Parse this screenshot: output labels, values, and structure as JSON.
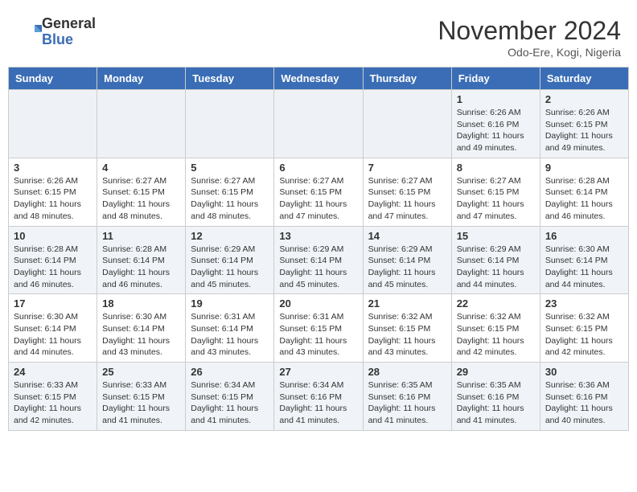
{
  "header": {
    "logo_general": "General",
    "logo_blue": "Blue",
    "month_title": "November 2024",
    "location": "Odo-Ere, Kogi, Nigeria"
  },
  "days_of_week": [
    "Sunday",
    "Monday",
    "Tuesday",
    "Wednesday",
    "Thursday",
    "Friday",
    "Saturday"
  ],
  "weeks": [
    [
      {
        "day": "",
        "info": ""
      },
      {
        "day": "",
        "info": ""
      },
      {
        "day": "",
        "info": ""
      },
      {
        "day": "",
        "info": ""
      },
      {
        "day": "",
        "info": ""
      },
      {
        "day": "1",
        "info": "Sunrise: 6:26 AM\nSunset: 6:16 PM\nDaylight: 11 hours\nand 49 minutes."
      },
      {
        "day": "2",
        "info": "Sunrise: 6:26 AM\nSunset: 6:15 PM\nDaylight: 11 hours\nand 49 minutes."
      }
    ],
    [
      {
        "day": "3",
        "info": "Sunrise: 6:26 AM\nSunset: 6:15 PM\nDaylight: 11 hours\nand 48 minutes."
      },
      {
        "day": "4",
        "info": "Sunrise: 6:27 AM\nSunset: 6:15 PM\nDaylight: 11 hours\nand 48 minutes."
      },
      {
        "day": "5",
        "info": "Sunrise: 6:27 AM\nSunset: 6:15 PM\nDaylight: 11 hours\nand 48 minutes."
      },
      {
        "day": "6",
        "info": "Sunrise: 6:27 AM\nSunset: 6:15 PM\nDaylight: 11 hours\nand 47 minutes."
      },
      {
        "day": "7",
        "info": "Sunrise: 6:27 AM\nSunset: 6:15 PM\nDaylight: 11 hours\nand 47 minutes."
      },
      {
        "day": "8",
        "info": "Sunrise: 6:27 AM\nSunset: 6:15 PM\nDaylight: 11 hours\nand 47 minutes."
      },
      {
        "day": "9",
        "info": "Sunrise: 6:28 AM\nSunset: 6:14 PM\nDaylight: 11 hours\nand 46 minutes."
      }
    ],
    [
      {
        "day": "10",
        "info": "Sunrise: 6:28 AM\nSunset: 6:14 PM\nDaylight: 11 hours\nand 46 minutes."
      },
      {
        "day": "11",
        "info": "Sunrise: 6:28 AM\nSunset: 6:14 PM\nDaylight: 11 hours\nand 46 minutes."
      },
      {
        "day": "12",
        "info": "Sunrise: 6:29 AM\nSunset: 6:14 PM\nDaylight: 11 hours\nand 45 minutes."
      },
      {
        "day": "13",
        "info": "Sunrise: 6:29 AM\nSunset: 6:14 PM\nDaylight: 11 hours\nand 45 minutes."
      },
      {
        "day": "14",
        "info": "Sunrise: 6:29 AM\nSunset: 6:14 PM\nDaylight: 11 hours\nand 45 minutes."
      },
      {
        "day": "15",
        "info": "Sunrise: 6:29 AM\nSunset: 6:14 PM\nDaylight: 11 hours\nand 44 minutes."
      },
      {
        "day": "16",
        "info": "Sunrise: 6:30 AM\nSunset: 6:14 PM\nDaylight: 11 hours\nand 44 minutes."
      }
    ],
    [
      {
        "day": "17",
        "info": "Sunrise: 6:30 AM\nSunset: 6:14 PM\nDaylight: 11 hours\nand 44 minutes."
      },
      {
        "day": "18",
        "info": "Sunrise: 6:30 AM\nSunset: 6:14 PM\nDaylight: 11 hours\nand 43 minutes."
      },
      {
        "day": "19",
        "info": "Sunrise: 6:31 AM\nSunset: 6:14 PM\nDaylight: 11 hours\nand 43 minutes."
      },
      {
        "day": "20",
        "info": "Sunrise: 6:31 AM\nSunset: 6:15 PM\nDaylight: 11 hours\nand 43 minutes."
      },
      {
        "day": "21",
        "info": "Sunrise: 6:32 AM\nSunset: 6:15 PM\nDaylight: 11 hours\nand 43 minutes."
      },
      {
        "day": "22",
        "info": "Sunrise: 6:32 AM\nSunset: 6:15 PM\nDaylight: 11 hours\nand 42 minutes."
      },
      {
        "day": "23",
        "info": "Sunrise: 6:32 AM\nSunset: 6:15 PM\nDaylight: 11 hours\nand 42 minutes."
      }
    ],
    [
      {
        "day": "24",
        "info": "Sunrise: 6:33 AM\nSunset: 6:15 PM\nDaylight: 11 hours\nand 42 minutes."
      },
      {
        "day": "25",
        "info": "Sunrise: 6:33 AM\nSunset: 6:15 PM\nDaylight: 11 hours\nand 41 minutes."
      },
      {
        "day": "26",
        "info": "Sunrise: 6:34 AM\nSunset: 6:15 PM\nDaylight: 11 hours\nand 41 minutes."
      },
      {
        "day": "27",
        "info": "Sunrise: 6:34 AM\nSunset: 6:16 PM\nDaylight: 11 hours\nand 41 minutes."
      },
      {
        "day": "28",
        "info": "Sunrise: 6:35 AM\nSunset: 6:16 PM\nDaylight: 11 hours\nand 41 minutes."
      },
      {
        "day": "29",
        "info": "Sunrise: 6:35 AM\nSunset: 6:16 PM\nDaylight: 11 hours\nand 41 minutes."
      },
      {
        "day": "30",
        "info": "Sunrise: 6:36 AM\nSunset: 6:16 PM\nDaylight: 11 hours\nand 40 minutes."
      }
    ]
  ]
}
